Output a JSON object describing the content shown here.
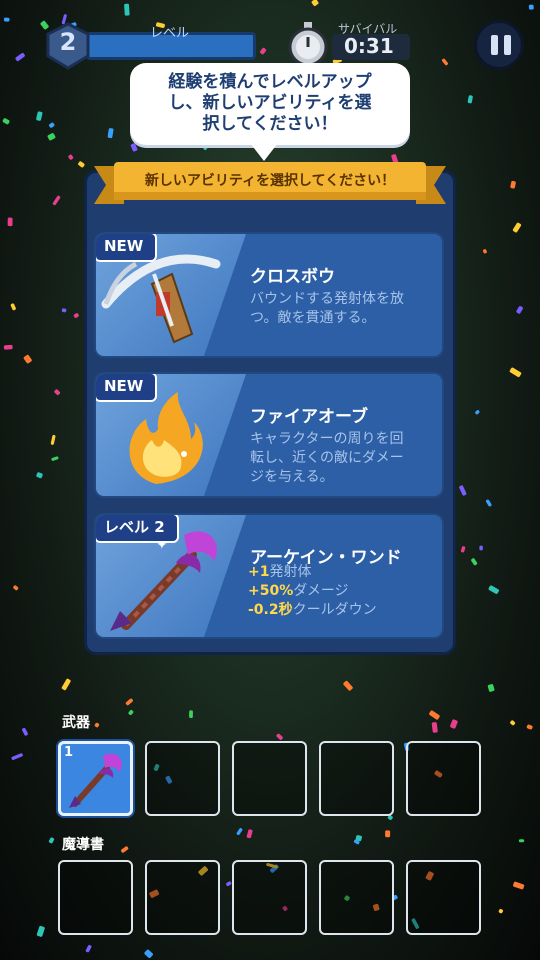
{
  "hud": {
    "level_label": "レベル",
    "level_number": "2",
    "timer_label": "サバイバル",
    "timer_value": "0:31"
  },
  "tooltip": {
    "lines": [
      "経験を積んでレベルアップ",
      "し、新しいアビリティを選",
      "択してください！"
    ]
  },
  "panel": {
    "ribbon_text": "新しいアビリティを選択してください！",
    "cards": [
      {
        "badge": "NEW",
        "title": "クロスボウ",
        "description_lines": [
          "バウンドする発射体を放",
          "つ。敵を貫通する。"
        ],
        "icon": "crossbow-icon"
      },
      {
        "badge": "NEW",
        "title": "ファイアオーブ",
        "description_lines": [
          "キャラクターの周りを回",
          "転し、近くの敵にダメー",
          "ジを与える。"
        ],
        "icon": "fire-orb-icon"
      },
      {
        "badge": "レベル 2",
        "title": "アーケイン・ワンド",
        "stats": [
          {
            "value": "+1",
            "text": "発射体"
          },
          {
            "value": "+50%",
            "text": "ダメージ"
          },
          {
            "value": "-0.2秒",
            "text": "クールダウン"
          }
        ],
        "icon": "arcane-wand-icon"
      }
    ]
  },
  "inventory": {
    "weapons_label": "武器",
    "tomes_label": "魔導書",
    "weapon_slots": [
      {
        "level": "1",
        "icon": "arcane-wand-icon"
      },
      {},
      {},
      {},
      {}
    ],
    "tome_slots": [
      {},
      {},
      {},
      {},
      {}
    ]
  },
  "colors": {
    "panel": "#1f3d6e",
    "card": "#2c5fa6",
    "ribbon": "#f2b431",
    "stat_highlight": "#ffd94a"
  }
}
